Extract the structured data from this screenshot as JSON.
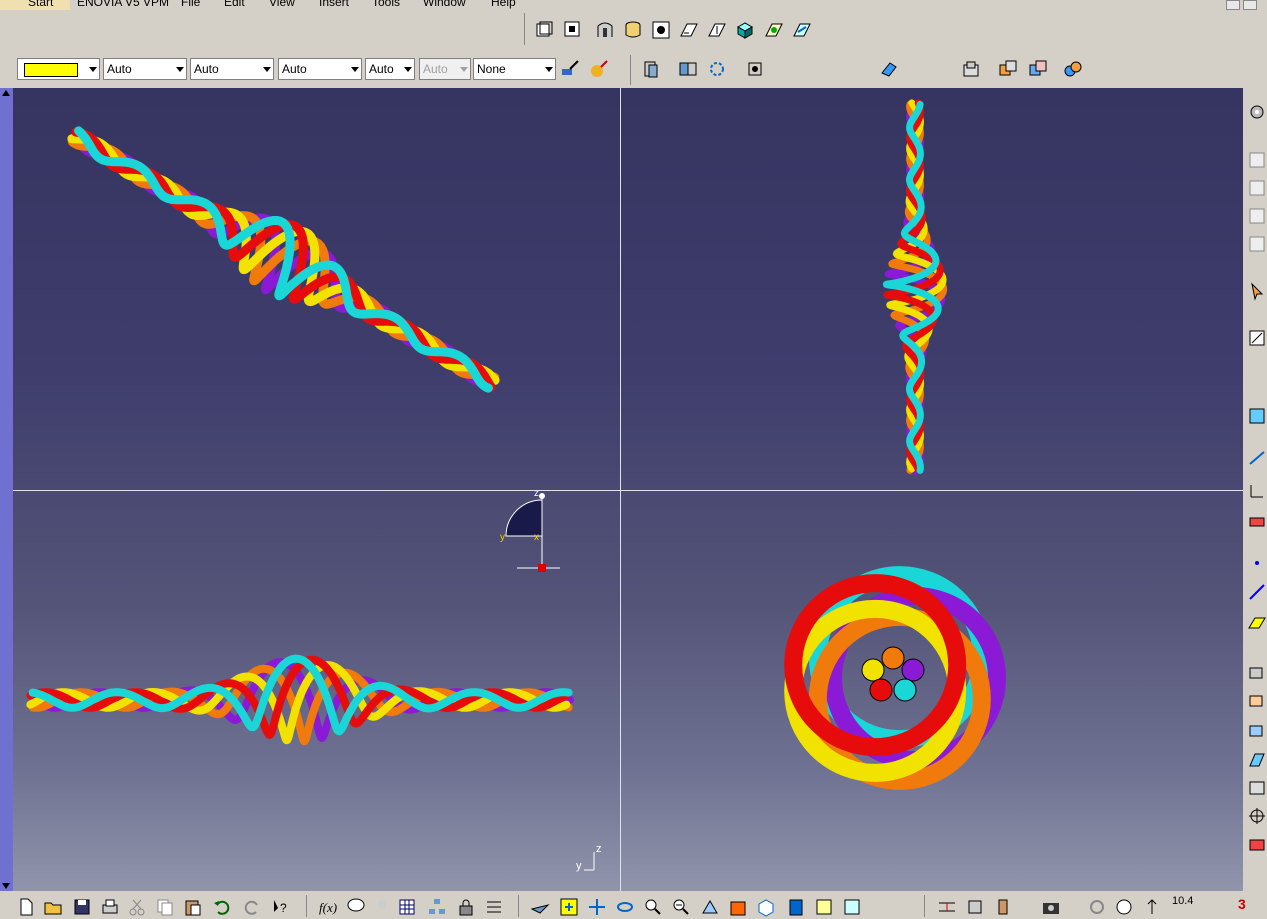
{
  "menu": {
    "items": [
      "Start",
      "ENOVIA V5 VPM",
      "File",
      "Edit",
      "View",
      "Insert",
      "Tools",
      "Window",
      "Help"
    ]
  },
  "properties_toolbar": {
    "fill_color": "#ffff00",
    "line_type": "Auto",
    "thickness": "Auto",
    "point_type": "Auto",
    "layer_value": "Auto",
    "transparency": "Auto",
    "none_value": "None"
  },
  "colors": {
    "wire_purple": "#8a1ad6",
    "wire_orange": "#f07a0c",
    "wire_yellow": "#f2e200",
    "wire_red": "#e60c0c",
    "wire_cyan": "#1ad6d6",
    "viewport_top": "#363460",
    "viewport_bottom": "#9095ab"
  },
  "compass": {
    "axis_z": "z",
    "axis_y": "y",
    "axis_x": "x"
  },
  "view_axis": {
    "axis_y": "y",
    "axis_z": "z"
  },
  "status": {
    "bottom_value": "10.4"
  }
}
